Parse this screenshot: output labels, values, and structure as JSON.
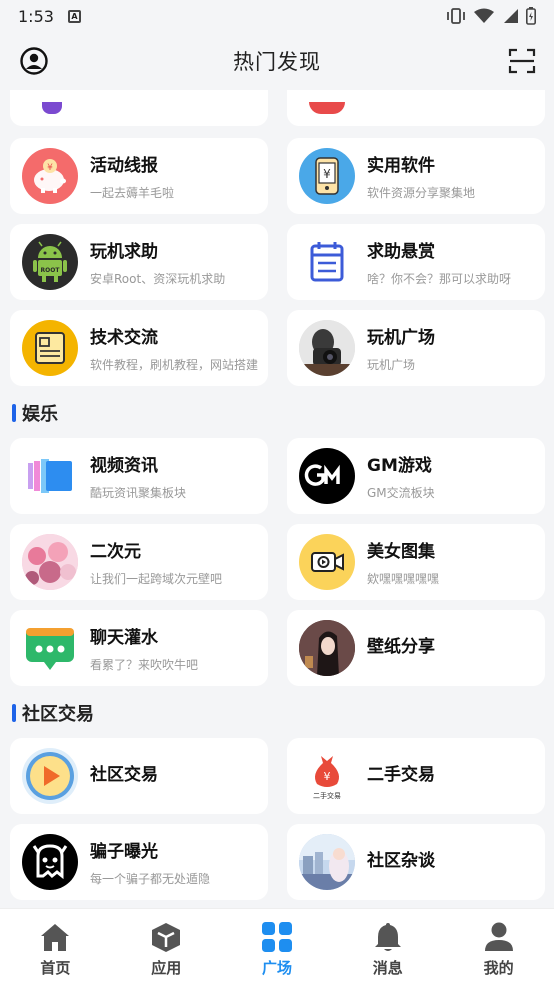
{
  "status": {
    "time": "1:53"
  },
  "header": {
    "title": "热门发现"
  },
  "colors": {
    "accent": "#1e8ef0",
    "section_bar": "#1e63e8"
  },
  "cards_top": [
    {
      "title": "活动线报",
      "subtitle": "一起去薅羊毛啦",
      "icon": "piggy-bank-icon"
    },
    {
      "title": "实用软件",
      "subtitle": "软件资源分享聚集地",
      "icon": "phone-yuan-icon"
    },
    {
      "title": "玩机求助",
      "subtitle": "安卓Root、资深玩机求助",
      "icon": "android-root-icon"
    },
    {
      "title": "求助悬赏",
      "subtitle": "啥？你不会？那可以求助呀",
      "icon": "notepad-icon"
    },
    {
      "title": "技术交流",
      "subtitle": "软件教程，刷机教程，网站搭建",
      "icon": "document-icon"
    },
    {
      "title": "玩机广场",
      "subtitle": "玩机广场",
      "icon": "camera-photo-icon"
    }
  ],
  "sections": [
    {
      "label": "娱乐",
      "cards": [
        {
          "title": "视频资讯",
          "subtitle": "酷玩资讯聚集板块",
          "icon": "video-cards-icon"
        },
        {
          "title": "GM游戏",
          "subtitle": "GM交流板块",
          "icon": "gm-logo-icon"
        },
        {
          "title": "二次元",
          "subtitle": "让我们一起跨域次元壁吧",
          "icon": "anime-avatar-icon"
        },
        {
          "title": "美女图集",
          "subtitle": "欸嘿嘿嘿嘿嘿",
          "icon": "video-camera-icon"
        },
        {
          "title": "聊天灌水",
          "subtitle": "看累了？来吹吹牛吧",
          "icon": "chat-bubble-icon"
        },
        {
          "title": "壁纸分享",
          "subtitle": "",
          "icon": "wallpaper-avatar-icon"
        }
      ]
    },
    {
      "label": "社区交易",
      "cards": [
        {
          "title": "社区交易",
          "subtitle": "",
          "icon": "play-disc-icon"
        },
        {
          "title": "二手交易",
          "subtitle": "",
          "icon": "money-bag-icon",
          "icon_caption": "二手交易"
        },
        {
          "title": "骗子曝光",
          "subtitle": "每一个骗子都无处遁隐",
          "icon": "ghost-icon"
        },
        {
          "title": "社区杂谈",
          "subtitle": "",
          "icon": "scenery-avatar-icon"
        }
      ]
    }
  ],
  "tabs": [
    {
      "label": "首页",
      "icon": "home-icon"
    },
    {
      "label": "应用",
      "icon": "cube-icon"
    },
    {
      "label": "广场",
      "icon": "grid-icon",
      "active": true
    },
    {
      "label": "消息",
      "icon": "bell-icon"
    },
    {
      "label": "我的",
      "icon": "person-icon"
    }
  ]
}
